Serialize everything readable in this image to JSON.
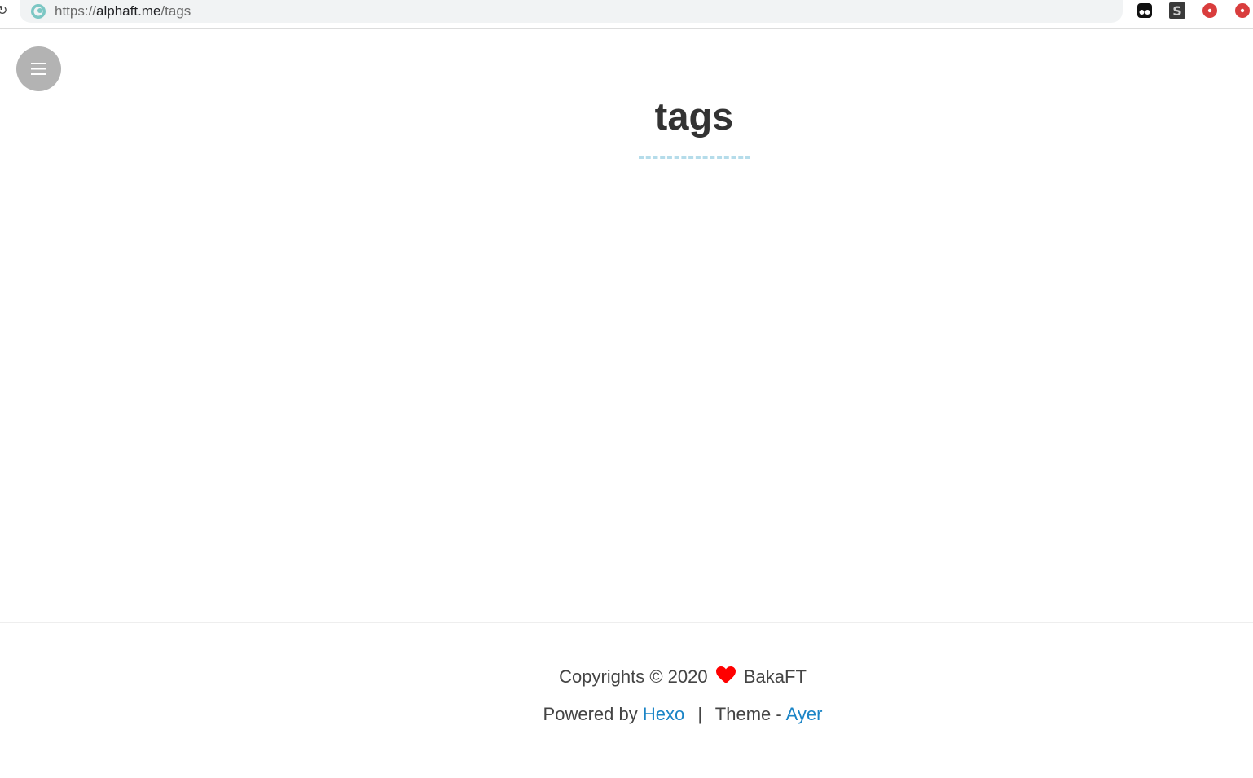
{
  "browser": {
    "url_scheme": "https://",
    "url_host": "alphaft.me",
    "url_path": "/tags",
    "extensions": [
      "mask-icon",
      "s-icon",
      "red-dot-icon",
      "red-dot-icon"
    ]
  },
  "page": {
    "title": "tags"
  },
  "footer": {
    "copyright_text": "Copyrights © 2020",
    "author": "BakaFT",
    "powered_by_label": "Powered by",
    "hexo_link": "Hexo",
    "separator": "|",
    "theme_label": "Theme -",
    "theme_link": "Ayer"
  },
  "colors": {
    "link": "#1a84c6",
    "heart": "#ff0000",
    "menu_button": "#b3b3b3",
    "title_underline": "#b5dcea"
  }
}
